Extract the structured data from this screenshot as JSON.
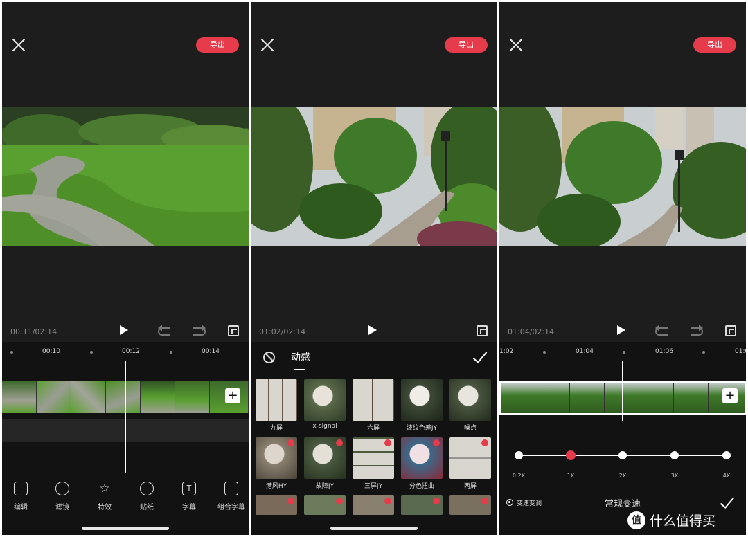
{
  "export_label": "导出",
  "panel_edit": {
    "time": "00:11/02:14",
    "ruler": [
      "00:10",
      "00:12",
      "00:14"
    ],
    "tools": [
      {
        "label": "编辑",
        "icon": "edit-icon"
      },
      {
        "label": "滤镜",
        "icon": "filter-icon"
      },
      {
        "label": "特效",
        "icon": "effects-icon"
      },
      {
        "label": "贴纸",
        "icon": "sticker-icon"
      },
      {
        "label": "字幕",
        "icon": "subtitle-icon"
      },
      {
        "label": "组合字幕",
        "icon": "combo-subtitle-icon"
      }
    ]
  },
  "panel_effects": {
    "time": "01:02/02:14",
    "category": "动感",
    "items": [
      "九屏",
      "x-signal",
      "六屏",
      "波纹色差JY",
      "噪点",
      "港风HY",
      "故障JY",
      "三屏JY",
      "分色扭曲",
      "两屏"
    ]
  },
  "panel_speed": {
    "time": "01:04/02:14",
    "ruler": [
      "1:02",
      "01:04",
      "01:06",
      "01:0"
    ],
    "speeds": [
      "0.2X",
      "1X",
      "2X",
      "3X",
      "4X"
    ],
    "selected_speed_index": 1,
    "pitch_option": "变速变调",
    "mode": "常规变速",
    "watermark": "什么值得买"
  },
  "colors": {
    "accent": "#e63b4b",
    "panel_bg": "#1d1d1d",
    "timeline_bg": "#121212"
  }
}
